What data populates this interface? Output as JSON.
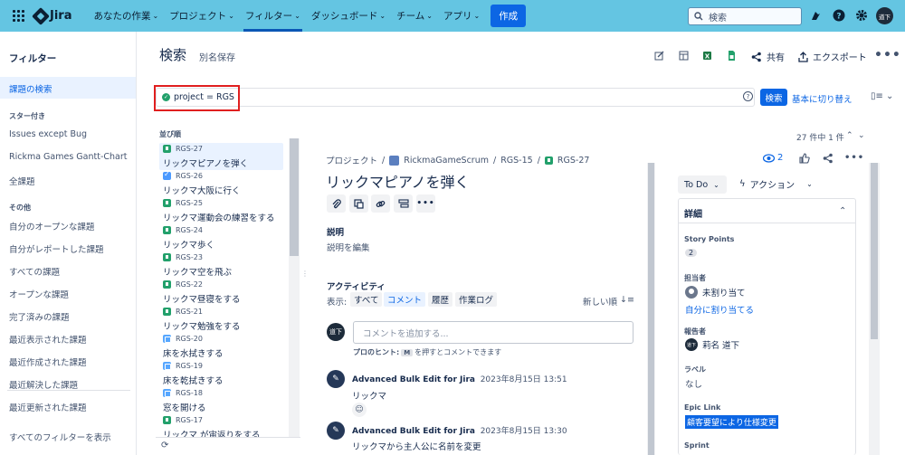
{
  "topnav": {
    "logo": "Jira",
    "items": [
      {
        "label": "あなたの作業"
      },
      {
        "label": "プロジェクト"
      },
      {
        "label": "フィルター"
      },
      {
        "label": "ダッシュボード"
      },
      {
        "label": "チーム"
      },
      {
        "label": "アプリ"
      }
    ],
    "create_label": "作成",
    "search_placeholder": "検索",
    "avatar_initials": "道下"
  },
  "sidebar": {
    "title": "フィルター",
    "active_item": "課題の検索",
    "starred_heading": "スター付き",
    "starred": [
      "Issues except Bug",
      "Rickma Games Gantt-Chart",
      "全課題"
    ],
    "other_heading": "その他",
    "other": [
      "自分のオープンな課題",
      "自分がレポートした課題",
      "すべての課題",
      "オープンな課題",
      "完了済みの課題",
      "最近表示された課題",
      "最近作成された課題",
      "最近解決した課題",
      "最近更新された課題"
    ],
    "view_all": "すべてのフィルターを表示"
  },
  "header": {
    "title": "検索",
    "save_as": "別名保存",
    "share": "共有",
    "export": "エクスポート"
  },
  "jql": {
    "query": "project = RGS",
    "search_button": "検索",
    "switch_basic": "基本に切り替え"
  },
  "issue_list": {
    "sort_label": "並び順",
    "issues": [
      {
        "key": "RGS-27",
        "summary": "リックマピアノを弾く",
        "type": "story",
        "selected": true
      },
      {
        "key": "RGS-26",
        "summary": "リックマ大阪に行く",
        "type": "task"
      },
      {
        "key": "RGS-25",
        "summary": "リックマ運動会の練習をする",
        "type": "story"
      },
      {
        "key": "RGS-24",
        "summary": "リックマ歩く",
        "type": "story"
      },
      {
        "key": "RGS-23",
        "summary": "リックマ空を飛ぶ",
        "type": "story"
      },
      {
        "key": "RGS-22",
        "summary": "リックマ昼寝をする",
        "type": "story"
      },
      {
        "key": "RGS-21",
        "summary": "リックマ勉強をする",
        "type": "story"
      },
      {
        "key": "RGS-20",
        "summary": "床を水拭きする",
        "type": "subtask"
      },
      {
        "key": "RGS-19",
        "summary": "床を乾拭きする",
        "type": "subtask"
      },
      {
        "key": "RGS-18",
        "summary": "窓を開ける",
        "type": "subtask"
      },
      {
        "key": "RGS-17",
        "summary": "リックマ が宙返りをする",
        "type": "story"
      }
    ]
  },
  "detail": {
    "counter": "27 件中 1 件",
    "breadcrumb": {
      "projects": "プロジェクト",
      "project": "RickmaGameScrum",
      "parent": "RGS-15",
      "key": "RGS-27"
    },
    "title": "リックマピアノを弾く",
    "description_label": "説明",
    "description_edit": "説明を編集",
    "activity_label": "アクティビティ",
    "show_label": "表示:",
    "filters": [
      "すべて",
      "コメント",
      "履歴",
      "作業ログ"
    ],
    "active_filter": "コメント",
    "sort_newest": "新しい順",
    "comment_placeholder": "コメントを追加する...",
    "comment_avatar": "道下",
    "protip": {
      "prefix": "プロのヒント:",
      "key": "M",
      "suffix": "を押すとコメントできます"
    },
    "activities": [
      {
        "author": "Advanced Bulk Edit for Jira",
        "date": "2023年8月15日 13:51",
        "text": "リックマ"
      },
      {
        "author": "Advanced Bulk Edit for Jira",
        "date": "2023年8月15日 13:30",
        "text": "リックマから主人公に名前を変更"
      }
    ]
  },
  "right_panel": {
    "watch_count": "2",
    "status": "To Do",
    "action": "アクション",
    "details_heading": "詳細",
    "story_points_label": "Story Points",
    "story_points": "2",
    "assignee_label": "担当者",
    "assignee": "未割り当て",
    "assign_to_me": "自分に割り当てる",
    "reporter_label": "報告者",
    "reporter": "莉名 道下",
    "reporter_initials": "道下",
    "labels_label": "ラベル",
    "labels": "なし",
    "epic_label": "Epic Link",
    "epic": "顧客要望により仕様変更",
    "sprint_label": "Sprint"
  },
  "colors": {
    "topnav_bg": "#64c5e2",
    "primary": "#0c66e4",
    "highlight_box": "#e01f1f",
    "story": "#22a06b",
    "task": "#4c9aff"
  }
}
